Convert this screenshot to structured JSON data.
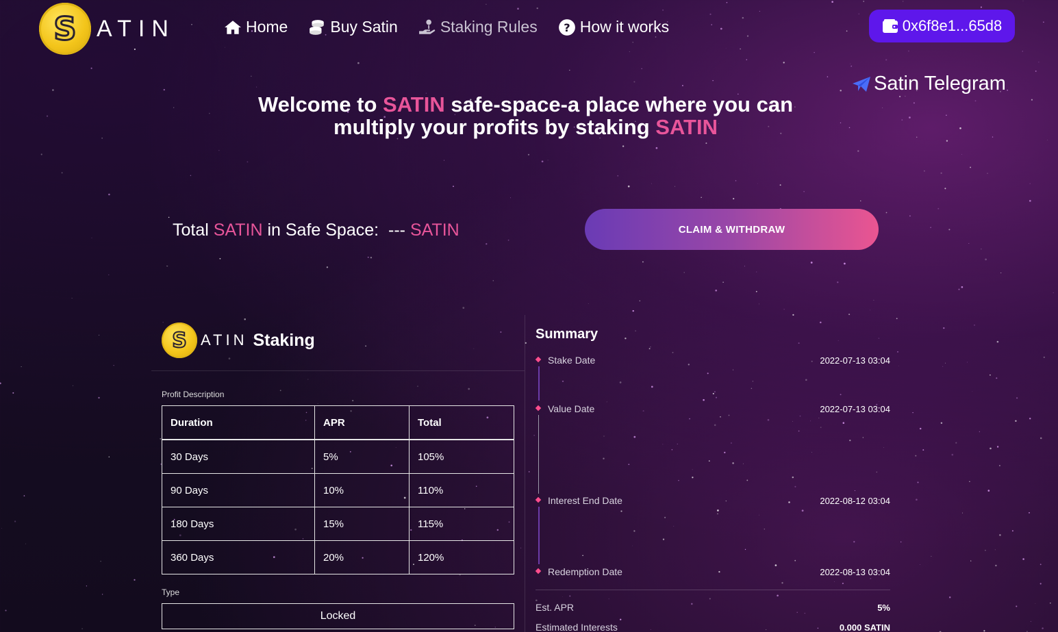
{
  "header": {
    "logo_letter": "S",
    "logo_text": "ATIN",
    "nav": [
      {
        "label": "Home",
        "icon": "home-icon"
      },
      {
        "label": "Buy Satin",
        "icon": "coins-icon"
      },
      {
        "label": "Staking Rules",
        "icon": "hand-coin-icon"
      },
      {
        "label": "How it works",
        "icon": "question-circle-icon"
      }
    ],
    "wallet_address": "0x6f8e1...65d8"
  },
  "telegram_label": "Satin Telegram",
  "hero": {
    "line1_a": "Welcome to ",
    "line1_brand": "SATIN",
    "line1_b": " safe-space-a place where you can",
    "line2_a": "multiply your profits by staking ",
    "line2_brand": "SATIN"
  },
  "total": {
    "prefix": "Total ",
    "brand": "SATIN",
    "middle": " in Safe Space:",
    "value": "---",
    "unit": "SATIN"
  },
  "claim_button": "CLAIM & WITHDRAW",
  "staking": {
    "brand": "ATIN",
    "title": "Staking",
    "profit_label": "Profit Description",
    "columns": [
      "Duration",
      "APR",
      "Total"
    ],
    "rows": [
      [
        "30 Days",
        "5%",
        "105%"
      ],
      [
        "90 Days",
        "10%",
        "110%"
      ],
      [
        "180 Days",
        "15%",
        "115%"
      ],
      [
        "360 Days",
        "20%",
        "120%"
      ]
    ],
    "type_label": "Type",
    "type_value": "Locked"
  },
  "summary": {
    "title": "Summary",
    "timeline": [
      {
        "label": "Stake Date",
        "value": "2022-07-13 03:04"
      },
      {
        "label": "Value Date",
        "value": "2022-07-13 03:04"
      },
      {
        "label": "Interest End Date",
        "value": "2022-08-12 03:04"
      },
      {
        "label": "Redemption Date",
        "value": "2022-08-13 03:04"
      }
    ],
    "apr_label": "Est. APR",
    "apr_value": "5%",
    "interest_label": "Estimated Interests",
    "interest_value": "0.000 SATIN"
  },
  "colors": {
    "accent_pink": "#e8559a",
    "wallet_purple": "#5e17eb",
    "timeline_dot": "#ff4d8d",
    "coin_gold": "#f3c51b"
  }
}
